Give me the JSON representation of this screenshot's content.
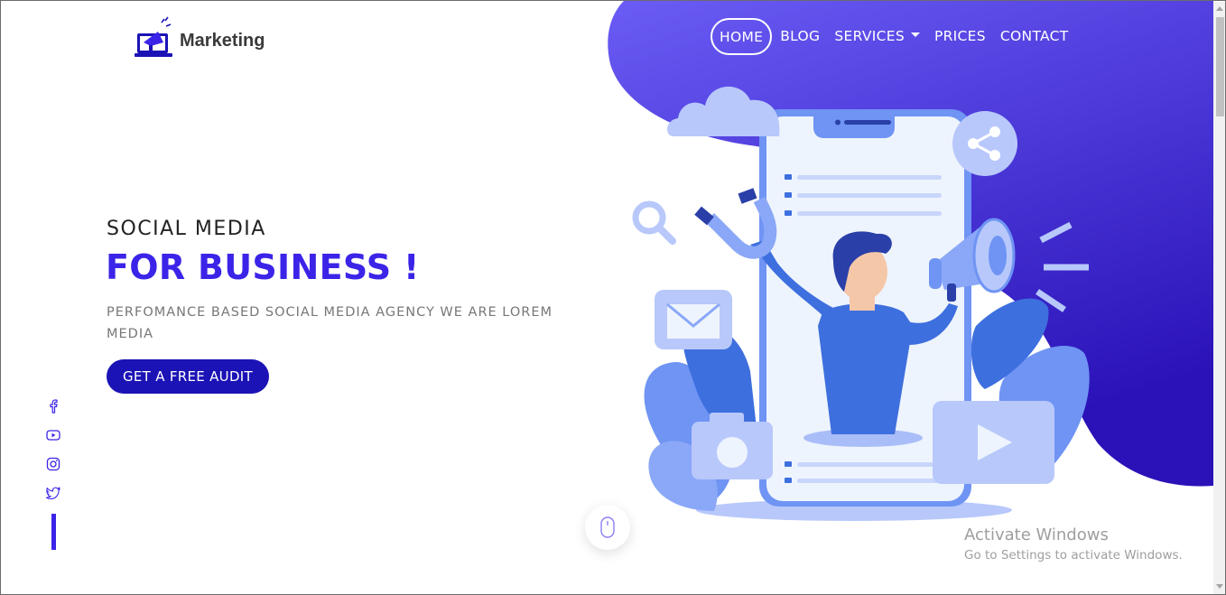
{
  "brand": {
    "name": "Marketing",
    "logo_icon": "megaphone-laptop-icon"
  },
  "nav": {
    "items": [
      {
        "label": "HOME",
        "active": true
      },
      {
        "label": "BLOG",
        "active": false
      },
      {
        "label": "SERVICES",
        "active": false,
        "has_dropdown": true
      },
      {
        "label": "PRICES",
        "active": false
      },
      {
        "label": "CONTACT",
        "active": false
      }
    ]
  },
  "hero": {
    "kicker": "SOCIAL MEDIA",
    "title": "FOR BUSINESS !",
    "subtitle": "PERFOMANCE BASED SOCIAL MEDIA AGENCY WE ARE LOREM MEDIA",
    "cta_label": "GET A FREE AUDIT"
  },
  "social_links": [
    {
      "icon": "facebook-icon"
    },
    {
      "icon": "youtube-icon"
    },
    {
      "icon": "instagram-icon"
    },
    {
      "icon": "twitter-icon"
    }
  ],
  "scroll_indicator": {
    "icon": "mouse-icon"
  },
  "watermark": {
    "title": "Activate Windows",
    "subtitle": "Go to Settings to activate Windows."
  },
  "colors": {
    "accent": "#3b24e8",
    "cta": "#1b13b5",
    "blob_top": "#6a5cf5",
    "blob_bottom": "#2a12b8",
    "illustration_light": "#b8c8fb",
    "illustration_mid": "#6f94f3",
    "illustration_dark": "#3e6fde"
  }
}
